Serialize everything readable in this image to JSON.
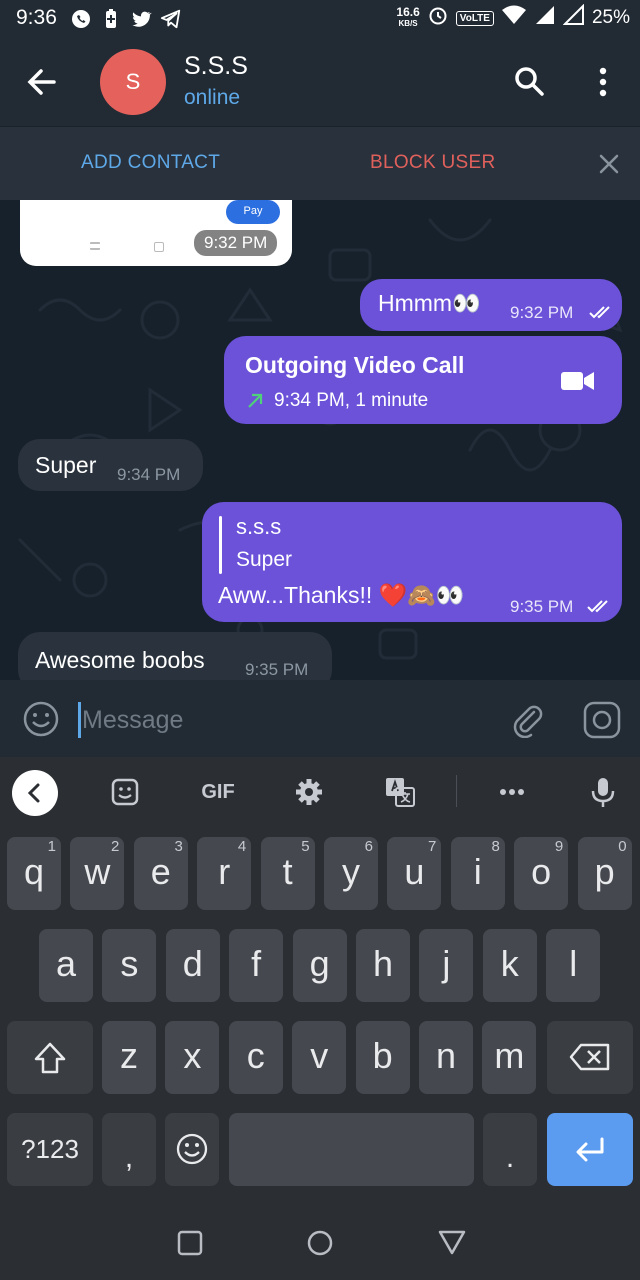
{
  "status_bar": {
    "time": "9:36",
    "speed": "16.6",
    "speed_unit": "KB/S",
    "volte": "VoLTE",
    "battery": "25%"
  },
  "header": {
    "avatar_letter": "S",
    "name": "S.S.S",
    "status": "online",
    "avatar_color": "#e5625c"
  },
  "action_bar": {
    "add_contact": "ADD CONTACT",
    "block_user": "BLOCK USER"
  },
  "chat": {
    "prev_card": {
      "pay_label": "Pay",
      "time": "9:32 PM"
    },
    "messages": [
      {
        "text": "Hmmm👀",
        "time": "9:32 PM",
        "direction": "out",
        "status": "read"
      },
      {
        "call_title": "Outgoing Video Call",
        "call_detail": "9:34 PM, 1 minute",
        "direction": "out"
      },
      {
        "text": "Super",
        "time": "9:34 PM",
        "direction": "in"
      },
      {
        "reply_name": "s.s.s",
        "reply_text": "Super",
        "text": "Aww...Thanks!! ❤️🙈👀",
        "time": "9:35 PM",
        "direction": "out",
        "status": "read"
      },
      {
        "text": "Awesome boobs",
        "time": "9:35 PM",
        "direction": "in"
      }
    ],
    "colors": {
      "outgoing": "#6b52d9",
      "incoming": "#2a333d",
      "background": "#17212b"
    }
  },
  "input": {
    "placeholder": "Message"
  },
  "keyboard": {
    "toolbar": {
      "gif": "GIF"
    },
    "row1": [
      {
        "key": "q",
        "num": "1"
      },
      {
        "key": "w",
        "num": "2"
      },
      {
        "key": "e",
        "num": "3"
      },
      {
        "key": "r",
        "num": "4"
      },
      {
        "key": "t",
        "num": "5"
      },
      {
        "key": "y",
        "num": "6"
      },
      {
        "key": "u",
        "num": "7"
      },
      {
        "key": "i",
        "num": "8"
      },
      {
        "key": "o",
        "num": "9"
      },
      {
        "key": "p",
        "num": "0"
      }
    ],
    "row2": [
      "a",
      "s",
      "d",
      "f",
      "g",
      "h",
      "j",
      "k",
      "l"
    ],
    "row3": [
      "z",
      "x",
      "c",
      "v",
      "b",
      "n",
      "m"
    ],
    "bottom": {
      "symbols": "?123",
      "comma": ",",
      "period": "."
    }
  }
}
